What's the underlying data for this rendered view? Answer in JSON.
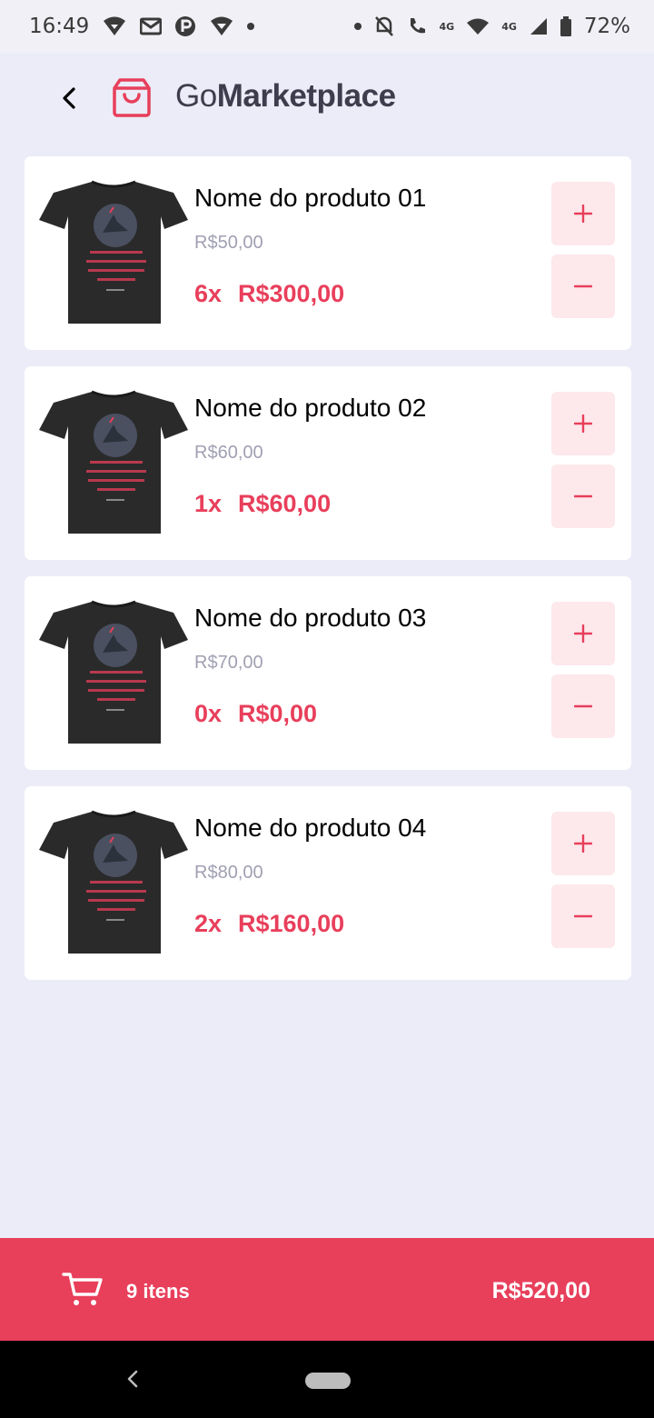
{
  "status_bar": {
    "time": "16:49",
    "network_label": "4G",
    "network_label_2": "4G",
    "battery": "72%"
  },
  "header": {
    "logo_prefix": "Go",
    "logo_bold": "Marketplace",
    "back_icon": "chevron-left-icon",
    "logo_icon": "shopping-bag-icon"
  },
  "products": [
    {
      "title": "Nome do produto 01",
      "price": "R$50,00",
      "quantity": "6x",
      "subtotal": "R$300,00"
    },
    {
      "title": "Nome do produto 02",
      "price": "R$60,00",
      "quantity": "1x",
      "subtotal": "R$60,00"
    },
    {
      "title": "Nome do produto 03",
      "price": "R$70,00",
      "quantity": "0x",
      "subtotal": "R$0,00"
    },
    {
      "title": "Nome do produto 04",
      "price": "R$80,00",
      "quantity": "2x",
      "subtotal": "R$160,00"
    }
  ],
  "footer": {
    "items_count": "9 itens",
    "total": "R$520,00",
    "cart_icon": "cart-icon"
  },
  "colors": {
    "accent": "#e83f5b",
    "background": "#ebecf7",
    "button_bg": "#fde8ec",
    "muted_text": "#a0a0b3"
  }
}
